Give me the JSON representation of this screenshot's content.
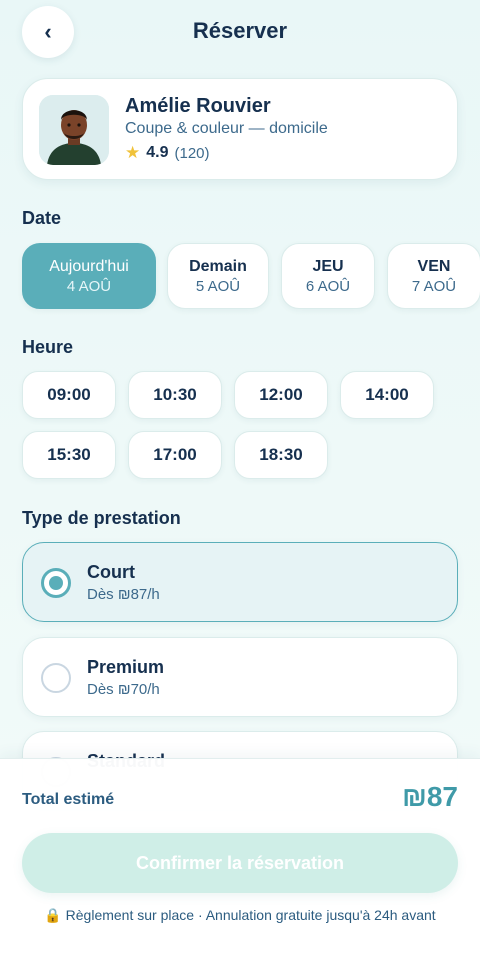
{
  "header": {
    "back_icon": "chevron-left-icon",
    "back_glyph": "‹",
    "title": "Réserver"
  },
  "professional": {
    "name": "Amélie Rouvier",
    "specialty": "Coupe & couleur — domicile",
    "star_glyph": "★",
    "rating": "4.9",
    "reviews": "(120)"
  },
  "date_section": {
    "label": "Date",
    "options": [
      {
        "day": "Aujourd'hui",
        "date": "4 AOÛ",
        "selected": true
      },
      {
        "day": "Demain",
        "date": "5 AOÛ",
        "selected": false
      },
      {
        "day": "JEU",
        "date": "6 AOÛ",
        "selected": false
      },
      {
        "day": "VEN",
        "date": "7 AOÛ",
        "selected": false
      }
    ]
  },
  "time_section": {
    "label": "Heure",
    "slots": [
      "09:00",
      "10:30",
      "12:00",
      "14:00",
      "15:30",
      "17:00",
      "18:30"
    ]
  },
  "service_section": {
    "label": "Type de prestation",
    "options": [
      {
        "name": "Court",
        "price": "Dès ₪87/h",
        "selected": true
      },
      {
        "name": "Premium",
        "price": "Dès ₪70/h",
        "selected": false
      },
      {
        "name": "Standard",
        "price": "",
        "selected": false
      }
    ]
  },
  "footer": {
    "total_label": "Total estimé",
    "total_value": "₪87",
    "confirm_label": "Confirmer la réservation",
    "note": "🔒 Règlement sur place · Annulation gratuite jusqu'à 24h avant"
  },
  "colors": {
    "accent": "#5aaeb9",
    "total": "#3f9aa8",
    "confirm_bg": "#cfeee7",
    "text_dark": "#16304f",
    "text_muted": "#3d6a8c",
    "star": "#f0c23a"
  }
}
